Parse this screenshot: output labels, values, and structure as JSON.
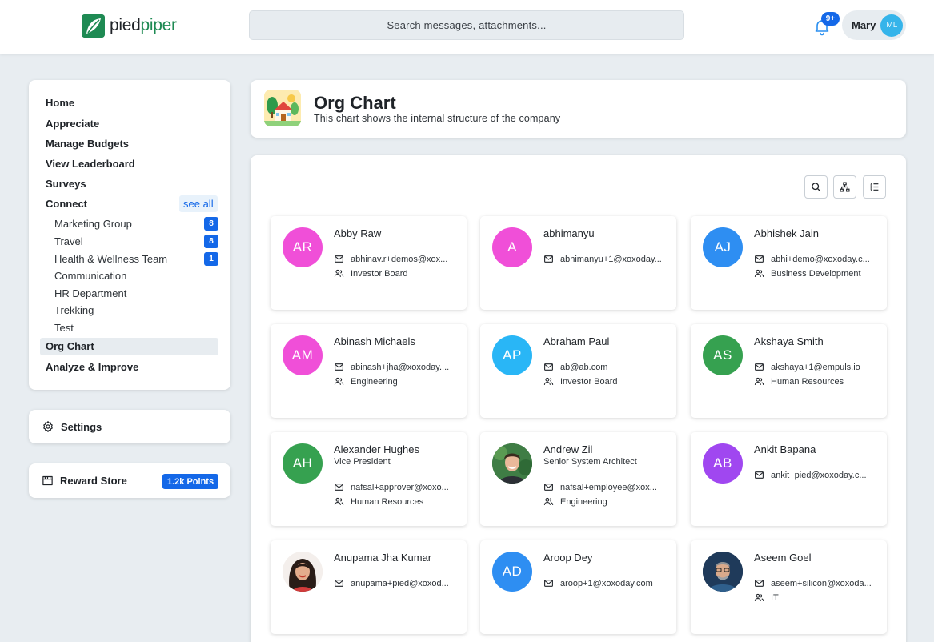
{
  "header": {
    "logo_part1": "pied",
    "logo_part2": "piper",
    "search_placeholder": "Search messages, attachments...",
    "notification_count": "9+",
    "user_name": "Mary",
    "user_initials": "ML"
  },
  "sidebar": {
    "items": {
      "home": "Home",
      "appreciate": "Appreciate",
      "manage_budgets": "Manage Budgets",
      "view_leaderboard": "View Leaderboard",
      "surveys": "Surveys",
      "connect": "Connect",
      "see_all": "see all",
      "org_chart": "Org Chart",
      "analyze_improve": "Analyze & Improve"
    },
    "groups": [
      {
        "label": "Marketing Group",
        "count": "8"
      },
      {
        "label": "Travel",
        "count": "8"
      },
      {
        "label": "Health & Wellness Team",
        "count": "1"
      },
      {
        "label": "Communication",
        "count": null
      },
      {
        "label": "HR Department",
        "count": null
      },
      {
        "label": "Trekking",
        "count": null
      },
      {
        "label": "Test",
        "count": null
      }
    ],
    "settings_label": "Settings",
    "reward_store_label": "Reward Store",
    "points": "1.2k Points"
  },
  "page": {
    "title": "Org Chart",
    "subtitle": "This chart shows the internal structure of the company"
  },
  "colors": {
    "accent": "#1468e8",
    "brand": "#1e8a53",
    "avatar_pink": "#f04fd8",
    "avatar_blue": "#2e8ef2",
    "avatar_sky": "#29b6f6",
    "avatar_green": "#36a150",
    "avatar_purple": "#a047f0"
  },
  "people": [
    {
      "name": "Abby Raw",
      "initials": "AR",
      "title": "",
      "email": "abhinav.r+demos@xox...",
      "department": "Investor Board"
    },
    {
      "name": "abhimanyu",
      "initials": "A",
      "title": "",
      "email": "abhimanyu+1@xoxoday...",
      "department": ""
    },
    {
      "name": "Abhishek Jain",
      "initials": "AJ",
      "title": "",
      "email": "abhi+demo@xoxoday.c...",
      "department": "Business Development"
    },
    {
      "name": "Abinash Michaels",
      "initials": "AM",
      "title": "",
      "email": "abinash+jha@xoxoday....",
      "department": "Engineering"
    },
    {
      "name": "Abraham Paul",
      "initials": "AP",
      "title": "",
      "email": "ab@ab.com",
      "department": "Investor Board"
    },
    {
      "name": "Akshaya Smith",
      "initials": "AS",
      "title": "",
      "email": "akshaya+1@empuls.io",
      "department": "Human Resources"
    },
    {
      "name": "Alexander Hughes",
      "initials": "AH",
      "title": "Vice President",
      "email": "nafsal+approver@xoxo...",
      "department": "Human Resources"
    },
    {
      "name": "Andrew Zil",
      "initials": "",
      "title": "Senior System Architect",
      "email": "nafsal+employee@xox...",
      "department": "Engineering"
    },
    {
      "name": "Ankit Bapana",
      "initials": "AB",
      "title": "",
      "email": "ankit+pied@xoxoday.c...",
      "department": ""
    },
    {
      "name": "Anupama Jha Kumar",
      "initials": "",
      "title": "",
      "email": "anupama+pied@xoxod...",
      "department": ""
    },
    {
      "name": "Aroop Dey",
      "initials": "AD",
      "title": "",
      "email": "aroop+1@xoxoday.com",
      "department": ""
    },
    {
      "name": "Aseem Goel",
      "initials": "",
      "title": "",
      "email": "aseem+silicon@xoxoda...",
      "department": "IT"
    }
  ]
}
